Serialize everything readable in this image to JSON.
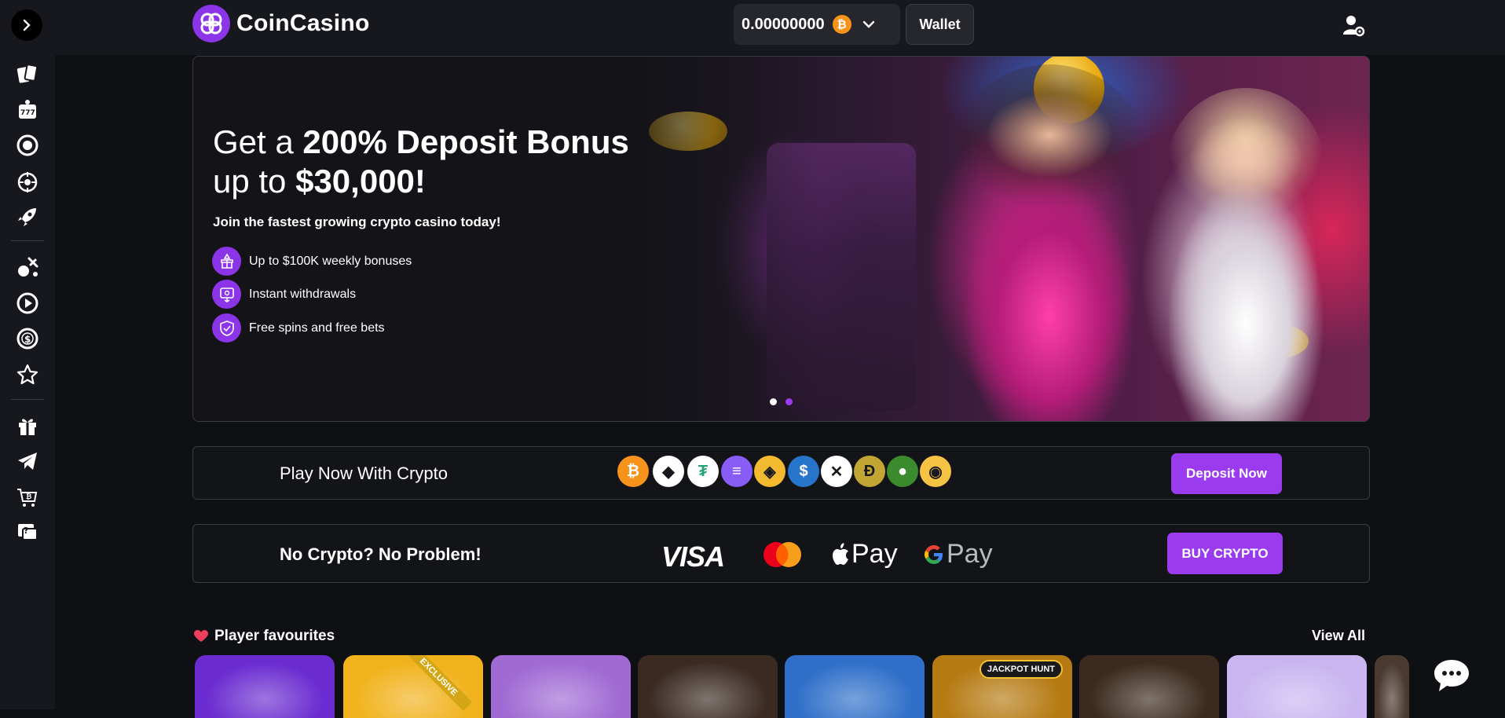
{
  "brand": {
    "name": "CoinCasino",
    "accent": "#8b34e8"
  },
  "header": {
    "balance": "0.00000000",
    "currency_symbol": "₿",
    "wallet_label": "Wallet"
  },
  "sidebar": {
    "items": [
      {
        "icon": "cards-icon"
      },
      {
        "icon": "slot-machine-icon"
      },
      {
        "icon": "poker-chip-icon"
      },
      {
        "icon": "roulette-icon"
      },
      {
        "icon": "rocket-icon"
      },
      {
        "icon": "sports-icon"
      },
      {
        "icon": "live-play-icon"
      },
      {
        "icon": "dollar-coin-icon"
      },
      {
        "icon": "star-icon"
      },
      {
        "icon": "gift-icon"
      },
      {
        "icon": "telegram-icon"
      },
      {
        "icon": "buy-crypto-cart-icon"
      },
      {
        "icon": "help-chat-icon"
      }
    ]
  },
  "hero": {
    "title_plain_1": "Get a ",
    "title_bold_1": "200% Deposit Bonus",
    "title_plain_2": "up to ",
    "title_bold_2": "$30,000!",
    "subtitle": "Join the fastest growing crypto casino today!",
    "features": [
      {
        "label": "Up to $100K weekly bonuses",
        "icon": "bonus-icon"
      },
      {
        "label": "Instant withdrawals",
        "icon": "withdraw-icon"
      },
      {
        "label": "Free spins and free bets",
        "icon": "shield-check-icon"
      }
    ],
    "slides": 2,
    "active_slide": 1
  },
  "crypto": {
    "title": "Play Now With Crypto",
    "coins": [
      {
        "name": "bitcoin",
        "glyph": "₿",
        "color": "#f7931a"
      },
      {
        "name": "ethereum",
        "glyph": "◆",
        "color": "#ffffff"
      },
      {
        "name": "tether",
        "glyph": "₮",
        "color": "#ffffff"
      },
      {
        "name": "solana",
        "glyph": "≡",
        "color": "#8a5cf6"
      },
      {
        "name": "bnb",
        "glyph": "◈",
        "color": "#f3ba2f"
      },
      {
        "name": "usd-coin",
        "glyph": "$",
        "color": "#2775ca"
      },
      {
        "name": "xrp",
        "glyph": "✕",
        "color": "#ffffff"
      },
      {
        "name": "dogecoin",
        "glyph": "Ð",
        "color": "#c2a633"
      },
      {
        "name": "pepe",
        "glyph": "●",
        "color": "#3c8a2e"
      },
      {
        "name": "shiba",
        "glyph": "◉",
        "color": "#f6c344"
      }
    ],
    "cta": "Deposit Now"
  },
  "fiat": {
    "title": "No Crypto? No Problem!",
    "visa": "VISA",
    "apple_pay": "Pay",
    "google_pay": "Pay",
    "cta": "BUY CRYPTO"
  },
  "favourites": {
    "title": "Player favourites",
    "view_all": "View All",
    "tiles": [
      {
        "name": "coincasino-originals",
        "bg": "#6a2bd0"
      },
      {
        "name": "exclusive-coin",
        "bg": "#f1b21c",
        "badge": "EXCLUSIVE"
      },
      {
        "name": "zeus-lightning",
        "bg": "#a06ad4"
      },
      {
        "name": "temple-treasure",
        "bg": "#3a2a22"
      },
      {
        "name": "zeus-blue",
        "bg": "#2f6fc9"
      },
      {
        "name": "jackpot-hunt",
        "bg": "#b57a12",
        "badge": "JACKPOT HUNT"
      },
      {
        "name": "wild-west",
        "bg": "#3b2a1d"
      },
      {
        "name": "candy-egg",
        "bg": "#c9b6f0"
      },
      {
        "name": "partial-tile",
        "bg": "#4a3a30"
      }
    ]
  }
}
